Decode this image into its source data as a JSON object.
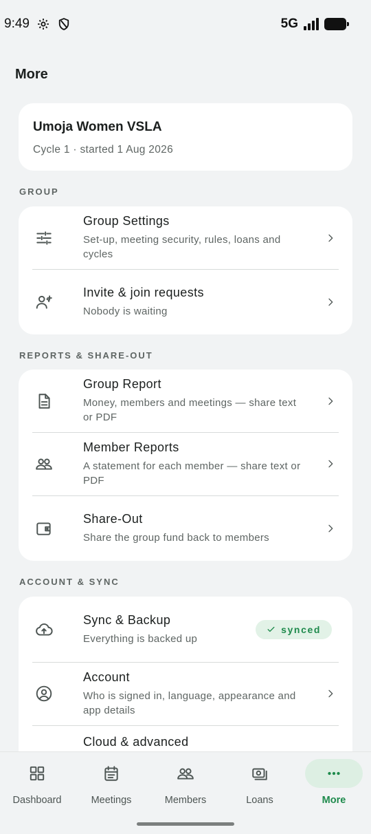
{
  "status_bar": {
    "time": "9:49",
    "network": "5G"
  },
  "page": {
    "title": "More"
  },
  "group": {
    "name": "Umoja Women VSLA",
    "cycle": "Cycle 1 · started 1 Aug 2026"
  },
  "sections": {
    "group": {
      "label": "GROUP",
      "items": [
        {
          "title": "Group Settings",
          "subtitle": "Set-up, meeting security, rules, loans and cycles",
          "icon": "sliders-icon"
        },
        {
          "title": "Invite & join requests",
          "subtitle": "Nobody is waiting",
          "icon": "person-add-icon"
        }
      ]
    },
    "reports": {
      "label": "REPORTS & SHARE-OUT",
      "items": [
        {
          "title": "Group Report",
          "subtitle": "Money, members and meetings — share text or PDF",
          "icon": "document-icon"
        },
        {
          "title": "Member Reports",
          "subtitle": "A statement for each member — share text or PDF",
          "icon": "people-icon"
        },
        {
          "title": "Share-Out",
          "subtitle": "Share the group fund back to members",
          "icon": "wallet-icon"
        }
      ]
    },
    "account": {
      "label": "ACCOUNT & SYNC",
      "items": [
        {
          "title": "Sync & Backup",
          "subtitle": "Everything is backed up",
          "badge": "synced",
          "icon": "cloud-upload-icon"
        },
        {
          "title": "Account",
          "subtitle": "Who is signed in, language, appearance and app details",
          "icon": "account-circle-icon"
        },
        {
          "title": "Cloud & advanced",
          "icon": "cloud-icon"
        }
      ]
    }
  },
  "bottom_nav": {
    "items": [
      {
        "label": "Dashboard",
        "icon": "grid-icon"
      },
      {
        "label": "Meetings",
        "icon": "calendar-icon"
      },
      {
        "label": "Members",
        "icon": "people-icon"
      },
      {
        "label": "Loans",
        "icon": "cash-icon"
      },
      {
        "label": "More",
        "icon": "more-icon",
        "active": true
      }
    ]
  },
  "colors": {
    "accent": "#1e8a4c",
    "accent_bg": "#ddefe3",
    "background": "#f1f3f4",
    "card": "#ffffff"
  }
}
